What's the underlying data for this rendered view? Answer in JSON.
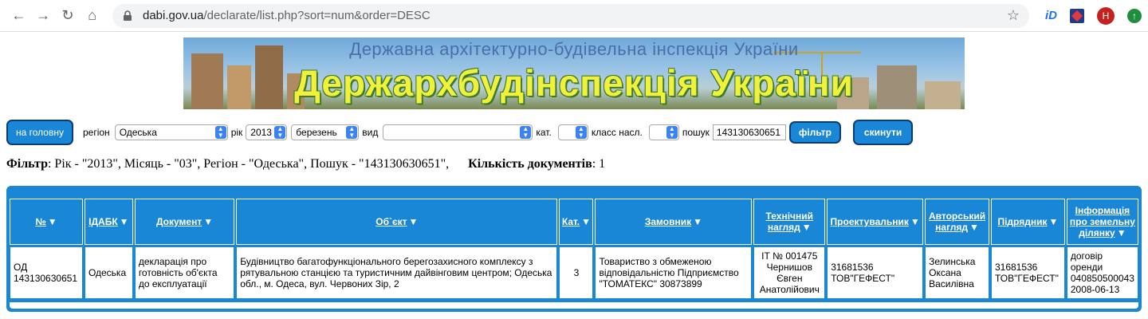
{
  "browser": {
    "url_host": "dabi.gov.ua",
    "url_path": "/declarate/list.php?sort=num&order=DESC",
    "ext_id_label": "iD",
    "avatar_letter": "H"
  },
  "banner": {
    "subtitle": "Державна архітектурно-будівельна інспекція України",
    "title": "Держархбудінспекція України"
  },
  "filters": {
    "home_button": "на головну",
    "region_label": "регіон",
    "region_value": "Одеська",
    "year_label": "рік",
    "year_value": "2013",
    "month_value": "березень",
    "type_label": "вид",
    "type_value": "",
    "cat_label": "кат.",
    "cat_value": "",
    "class_label": "класс насл.",
    "class_value": "",
    "search_label": "пошук",
    "search_value": "143130630651",
    "filter_button": "фільтр",
    "reset_button": "скинути"
  },
  "summary": {
    "filter_label": "Фільтр",
    "filter_text": ": Рік - \"2013\", Місяць - \"03\", Регіон - \"Одеська\", Пошук - \"143130630651\",",
    "count_label": "Кількість документів",
    "count_text": ": 1"
  },
  "table": {
    "headers": [
      "№",
      "ІДАБК",
      "Документ",
      "Об`єкт",
      "Кат.",
      "Замовник",
      "Технічний нагляд",
      "Проектувальник",
      "Авторський нагляд",
      "Підрядник",
      "Інформація про земельну ділянку"
    ],
    "rows": [
      {
        "num": "ОД 143130630651",
        "idabk": "Одеська",
        "document": "декларація про готовність об'єкта до експлуатації",
        "object": "Будівництво багатофункціонального берегозахисного комплексу з рятувальною станцією та туристичним дайвінговим центром; Одеська обл., м. Одеса, вул. Червоних Зір, 2",
        "cat": "3",
        "customer": "Товариство з обмеженою відповідальністю Підприємство \"ТОМАТЕКС\" 30873899",
        "tech_supervision": "ІТ № 001475 Чернишов Євген Анатолійович",
        "designer": "31681536 ТОВ\"ГЕФЕСТ\"",
        "author_supervision": "Зелинська Оксана Василівна",
        "contractor": "31681536 ТОВ\"ГЕФЕСТ\"",
        "land_info": "договір оренди 040850500043 2008-06-13"
      }
    ]
  },
  "colors": {
    "accent_blue": "#1a86d6",
    "banner_title_yellow": "#f1f03a"
  }
}
